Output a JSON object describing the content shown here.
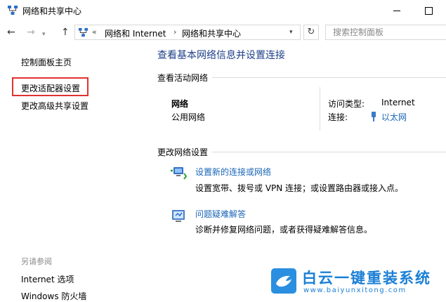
{
  "window": {
    "title": "网络和共享中心"
  },
  "address": {
    "chevron": "«",
    "segments": [
      "网络和 Internet",
      "网络和共享中心"
    ],
    "separator": "›",
    "search_placeholder": "搜索控制面板"
  },
  "sidebar": {
    "items": [
      {
        "label": "控制面板主页"
      },
      {
        "label": "更改适配器设置"
      },
      {
        "label": "更改高级共享设置"
      }
    ],
    "see_also_heading": "另请参阅",
    "see_also": [
      {
        "label": "Internet 选项"
      },
      {
        "label": "Windows 防火墙"
      }
    ]
  },
  "main": {
    "title": "查看基本网络信息并设置连接",
    "active_networks_label": "查看活动网络",
    "network": {
      "name": "网络",
      "type": "公用网络",
      "access_type_label": "访问类型:",
      "access_type_value": "Internet",
      "connections_label": "连接:",
      "connection_value": "以太网"
    },
    "change_settings_label": "更改网络设置",
    "tasks": [
      {
        "link": "设置新的连接或网络",
        "desc": "设置宽带、拨号或 VPN 连接；或设置路由器或接入点。",
        "icon": "new-connection-icon"
      },
      {
        "link": "问题疑难解答",
        "desc": "诊断并修复网络问题，或者获得疑难解答信息。",
        "icon": "troubleshoot-icon"
      }
    ]
  },
  "watermark": {
    "title": "白云一键重装系统",
    "url": "www.baiyunxitong.com"
  },
  "colors": {
    "link": "#1a65b5",
    "title": "#1e3f8a",
    "highlight": "#e0322f",
    "brand": "#1b7fd6"
  }
}
